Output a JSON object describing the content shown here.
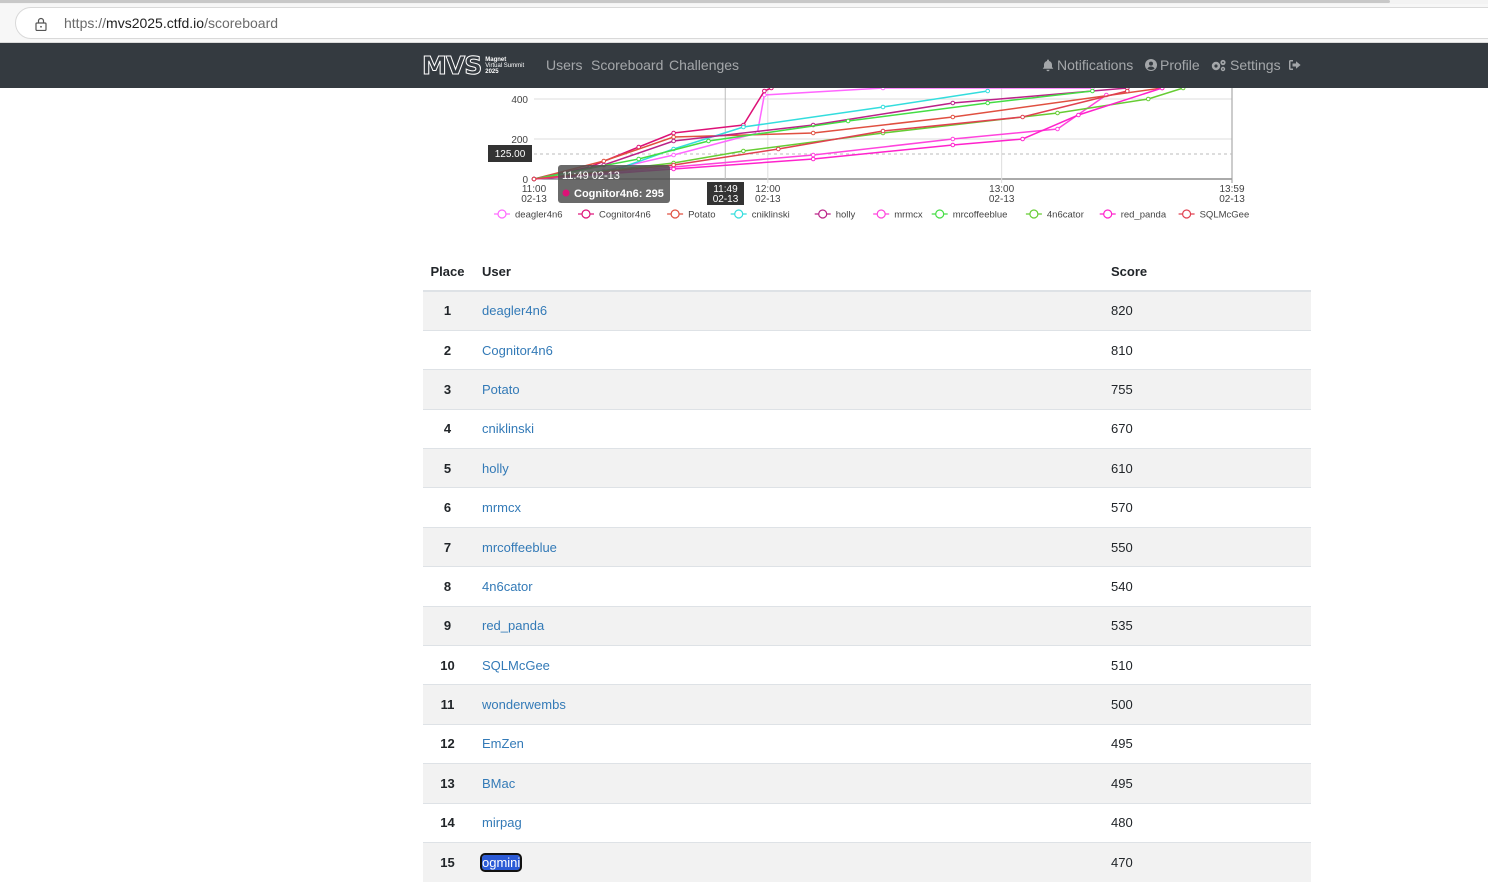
{
  "browser": {
    "url_prefix": "https://",
    "url_host": "mvs2025.ctfd.io",
    "url_path": "/scoreboard"
  },
  "navbar": {
    "logo_main": "MVS",
    "logo_line1": "Magnet",
    "logo_line2": "Virtual Summit",
    "logo_line3": "2025",
    "links": [
      "Users",
      "Scoreboard",
      "Challenges"
    ],
    "notifications": "Notifications",
    "profile": "Profile",
    "settings": "Settings"
  },
  "chart_data": {
    "type": "line",
    "title": "",
    "xlabel": "",
    "ylabel": "",
    "x_ticks": [
      "11:00\n02-13",
      "12:00\n02-13",
      "13:00\n02-13",
      "13:59\n02-13"
    ],
    "y_ticks": [
      0,
      200,
      400
    ],
    "ylim_visible": [
      0,
      450
    ],
    "crosshair": {
      "y_label": "125.00",
      "x_label": "11:49\n02-13"
    },
    "tooltip": {
      "title": "11:49 02-13",
      "series": "Cognitor4n6",
      "value": 295
    },
    "legend_position": "bottom",
    "series": [
      {
        "name": "deagler4n6",
        "color": "#ff66ff"
      },
      {
        "name": "Cognitor4n6",
        "color": "#dd1177"
      },
      {
        "name": "Potato",
        "color": "#e05040"
      },
      {
        "name": "cniklinski",
        "color": "#33dddd"
      },
      {
        "name": "holly",
        "color": "#bb2288"
      },
      {
        "name": "mrmcx",
        "color": "#ff44dd"
      },
      {
        "name": "mrcoffeeblue",
        "color": "#44dd44"
      },
      {
        "name": "4n6cator",
        "color": "#66cc33"
      },
      {
        "name": "red_panda",
        "color": "#ff22cc"
      },
      {
        "name": "SQLMcGee",
        "color": "#e04050"
      }
    ]
  },
  "table": {
    "headers": {
      "place": "Place",
      "user": "User",
      "score": "Score"
    },
    "rows": [
      {
        "place": "1",
        "user": "deagler4n6",
        "score": "820"
      },
      {
        "place": "2",
        "user": "Cognitor4n6",
        "score": "810"
      },
      {
        "place": "3",
        "user": "Potato",
        "score": "755"
      },
      {
        "place": "4",
        "user": "cniklinski",
        "score": "670"
      },
      {
        "place": "5",
        "user": "holly",
        "score": "610"
      },
      {
        "place": "6",
        "user": "mrmcx",
        "score": "570"
      },
      {
        "place": "7",
        "user": "mrcoffeeblue",
        "score": "550"
      },
      {
        "place": "8",
        "user": "4n6cator",
        "score": "540"
      },
      {
        "place": "9",
        "user": "red_panda",
        "score": "535"
      },
      {
        "place": "10",
        "user": "SQLMcGee",
        "score": "510"
      },
      {
        "place": "11",
        "user": "wonderwembs",
        "score": "500"
      },
      {
        "place": "12",
        "user": "EmZen",
        "score": "495"
      },
      {
        "place": "13",
        "user": "BMac",
        "score": "495"
      },
      {
        "place": "14",
        "user": "mirpag",
        "score": "480"
      },
      {
        "place": "15",
        "user": "ogmini",
        "score": "470"
      }
    ]
  }
}
